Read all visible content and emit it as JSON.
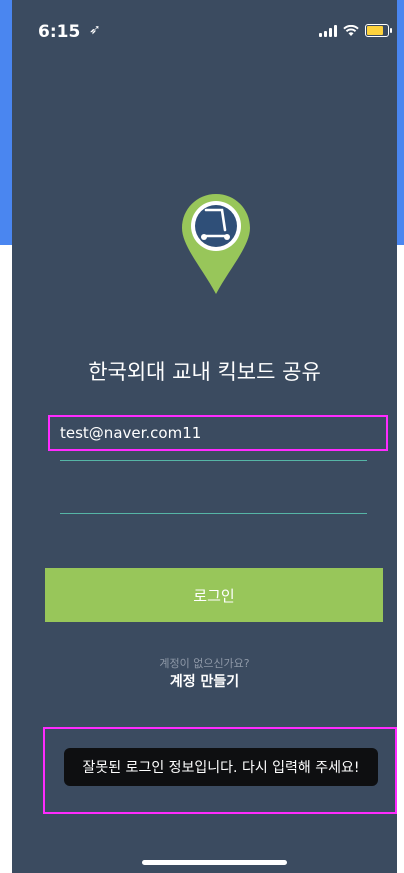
{
  "status_bar": {
    "time": "6:15",
    "location_icon": "location-arrow-icon",
    "signal_icon": "cellular-signal-icon",
    "wifi_icon": "wifi-icon",
    "battery_icon": "battery-icon",
    "battery_color": "#ffd33d"
  },
  "logo": {
    "icon": "scooter-location-pin-icon",
    "pin_color": "#98c65a",
    "circle_color": "#2f4f78"
  },
  "title": "한국외대 교내 킥보드 공유",
  "login_form": {
    "email_value": "test@naver.com11",
    "password_value": "",
    "login_button_label": "로그인",
    "underline_color": "#56b5a6"
  },
  "signup": {
    "question": "계정이 없으신가요?",
    "link_label": "계정 만들기"
  },
  "toast": {
    "message": "잘못된 로그인 정보입니다. 다시 입력해 주세요!"
  },
  "colors": {
    "background": "#3b4b60",
    "accent_green": "#98c65a",
    "highlight_magenta": "#ff2bff"
  }
}
